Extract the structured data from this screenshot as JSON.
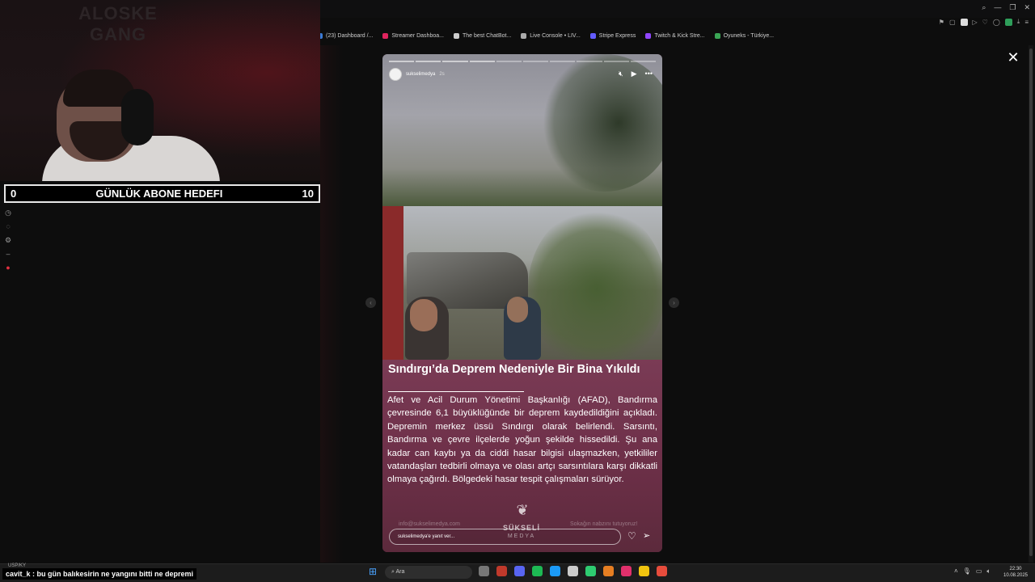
{
  "browser": {
    "bookmarks": [
      {
        "label": "(23) Dashboard /...",
        "color": "#3a7bd5"
      },
      {
        "label": "Streamer Dashboa...",
        "color": "#e0245e"
      },
      {
        "label": "The best ChatBot...",
        "color": "#cccccc"
      },
      {
        "label": "Live Console • LIV...",
        "color": "#aaaaaa"
      },
      {
        "label": "Stripe Express",
        "color": "#635bff"
      },
      {
        "label": "Twitch & Kick Stre...",
        "color": "#9146ff"
      },
      {
        "label": "Oyuneks - Türkiye...",
        "color": "#3aa655"
      }
    ]
  },
  "webcam": {
    "logo_text": "ALOSKE GANG"
  },
  "goal": {
    "current": "0",
    "label": "GÜNLÜK ABONE HEDEFI",
    "target": "10"
  },
  "story": {
    "username": "sukselimedya",
    "time": "2s",
    "headline": "Sındırgı’da Deprem Nedeniyle Bir Bina Yıkıldı",
    "body": "Afet ve Acil Durum Yönetimi Başkanlığı (AFAD), Bandırma çevresinde 6,1 büyüklüğünde bir deprem kaydedildiğini açıkladı. Depremin merkez üssü Sındırgı olarak belirlendi. Sarsıntı, Bandırma ve çevre ilçelerde yoğun şekilde hissedildi. Şu ana kadar can kaybı ya da ciddi hasar bilgisi ulaşmazken, yetkililer vatandaşları tedbirli olmaya ve olası artçı sarsıntılara karşı dikkatli olmaya çağırdı. Bölgedeki hasar tespit çalışmaları sürüyor.",
    "footer_left": "info@sukselimedya.com",
    "footer_right": "Sokağın nabzını tutuyoruz!",
    "brand_name": "SÜKSELİ",
    "brand_sub": "MEDYA",
    "reply_placeholder": "sukselimedya'e yanıt ver..."
  },
  "chat": {
    "user": "cavit_k",
    "message": " : bu gün balıkesirin ne yangını bitti ne depremi",
    "small": "USP/KY"
  },
  "taskbar": {
    "search_label": "Ara",
    "time": "22:30",
    "date": "10.08.2025",
    "app_colors": [
      "#777777",
      "#c0392b",
      "#5865f2",
      "#1db954",
      "#1b9af7",
      "#cccccc",
      "#2ecc71",
      "#e67e22",
      "#e1306c",
      "#f1c40f",
      "#e74c3c"
    ]
  }
}
